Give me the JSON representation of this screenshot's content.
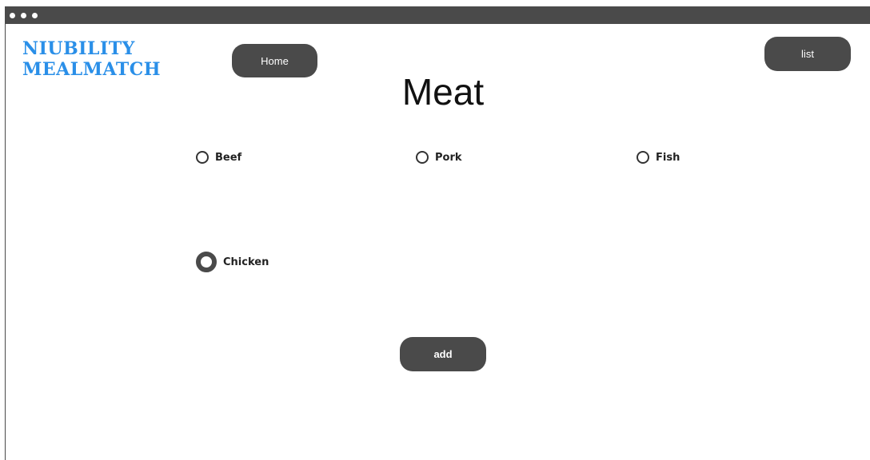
{
  "window": {
    "controls": [
      "dot",
      "dot",
      "dot"
    ]
  },
  "brand": {
    "line1": "NIUBILITY",
    "line2": "MEALMATCH",
    "color": "#2a8fe8"
  },
  "nav": {
    "home_label": "Home",
    "list_label": "list"
  },
  "page": {
    "title": "Meat"
  },
  "options": [
    {
      "label": "Beef",
      "selected": false
    },
    {
      "label": "Pork",
      "selected": false
    },
    {
      "label": "Fish",
      "selected": false
    },
    {
      "label": "Chicken",
      "selected": true
    }
  ],
  "actions": {
    "add_label": "add"
  },
  "colors": {
    "button_bg": "#4a4a4a",
    "titlebar_bg": "#4a4a4a"
  }
}
